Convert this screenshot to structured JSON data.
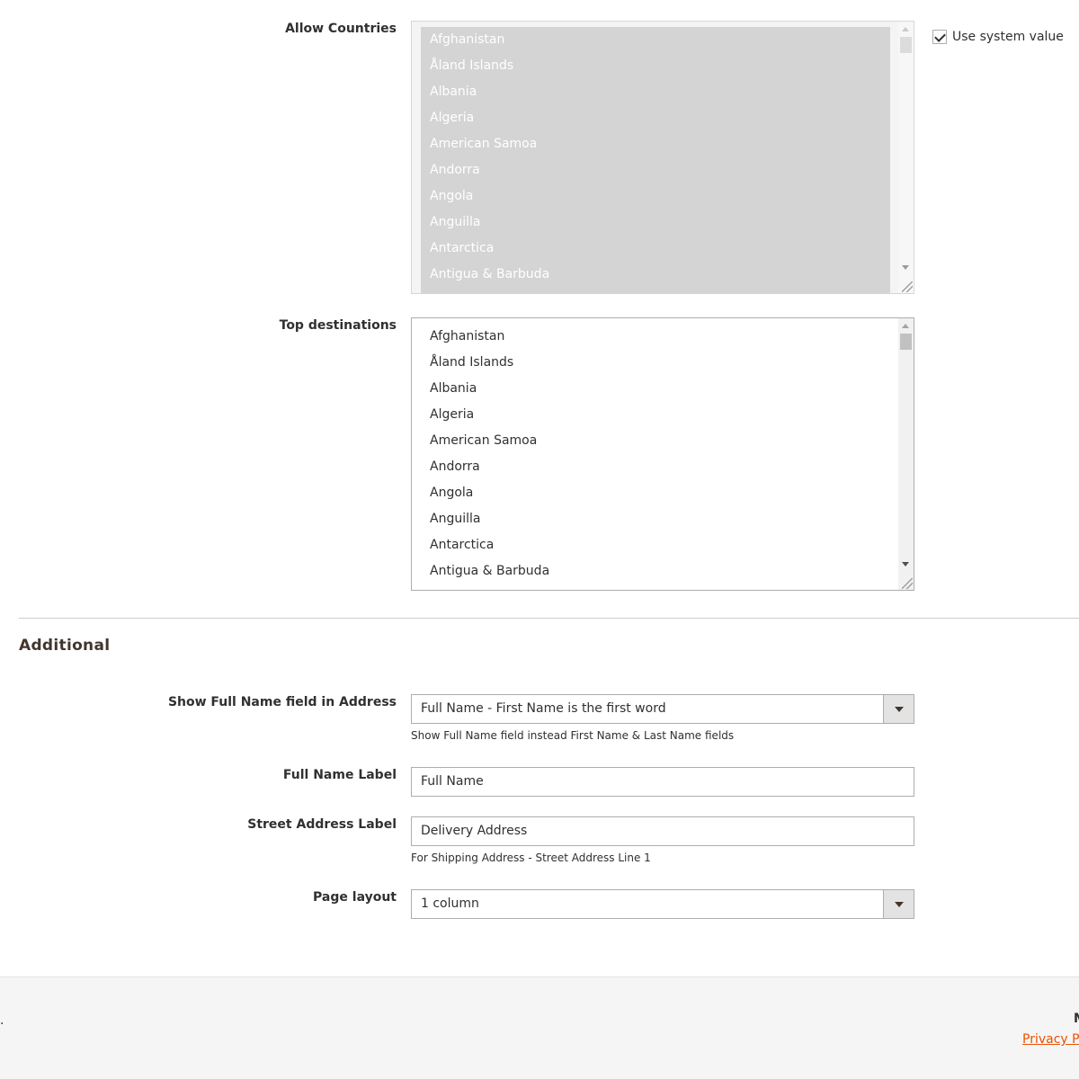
{
  "allow_countries": {
    "label": "Allow Countries",
    "options": [
      "Afghanistan",
      "Åland Islands",
      "Albania",
      "Algeria",
      "American Samoa",
      "Andorra",
      "Angola",
      "Anguilla",
      "Antarctica",
      "Antigua & Barbuda"
    ],
    "use_system_value_label": "Use system value",
    "use_system_value_checked": true
  },
  "top_destinations": {
    "label": "Top destinations",
    "options": [
      "Afghanistan",
      "Åland Islands",
      "Albania",
      "Algeria",
      "American Samoa",
      "Andorra",
      "Angola",
      "Anguilla",
      "Antarctica",
      "Antigua & Barbuda"
    ]
  },
  "additional": {
    "title": "Additional",
    "show_full_name": {
      "label": "Show Full Name field in Address",
      "value": "Full Name - First Name is the first word",
      "note": "Show Full Name field instead First Name & Last Name fields"
    },
    "full_name_label": {
      "label": "Full Name Label",
      "value": "Full Name"
    },
    "street_address_label": {
      "label": "Street Address Label",
      "value": "Delivery Address",
      "note": "For Shipping Address - Street Address Line 1"
    },
    "page_layout": {
      "label": "Page layout",
      "value": "1 column"
    }
  },
  "footer": {
    "left_fragment": ".",
    "right_fragment": "M",
    "privacy_link": "Privacy Po"
  },
  "icons": {
    "checkbox": "checkmark-icon",
    "select_caret": "chevron-down-icon",
    "scroll_up": "triangle-up-icon",
    "scroll_down": "triangle-down-icon",
    "resize": "resize-grip-icon"
  },
  "colors": {
    "link": "#eb5202",
    "disabled_selection": "#d4d4d4",
    "border": "#adadad",
    "footer_bg": "#f5f5f5"
  }
}
